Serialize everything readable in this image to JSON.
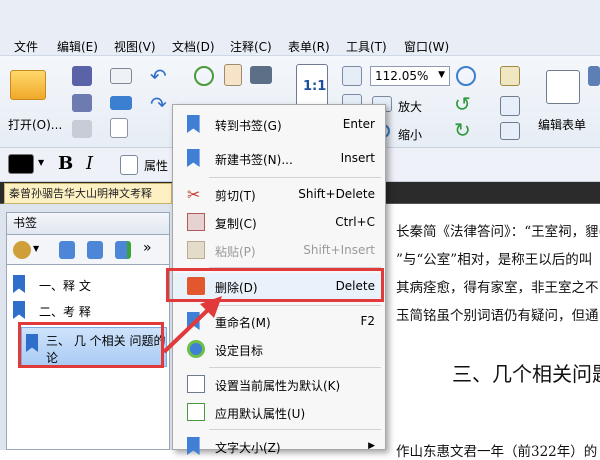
{
  "menubar": {
    "items": [
      "文件",
      "编辑(E)",
      "视图(V)",
      "文档(D)",
      "注释(C)",
      "表单(R)",
      "工具(T)",
      "窗口(W)"
    ]
  },
  "toolbar": {
    "open_label": "打开(O)...",
    "zoom_value": "112.05%",
    "fit_label": "1:1",
    "enlarge_label": "放大",
    "shrink_label": "缩小",
    "edit_form_label": "编辑表单",
    "bold_label": "B",
    "italic_label": "I",
    "props_label": "属性"
  },
  "tab": {
    "title": "秦曾孙骃告华大山明神文考释"
  },
  "bookmarks": {
    "panel_title": "书签",
    "items": [
      {
        "label": "一、释 文"
      },
      {
        "label": "二、考 释"
      },
      {
        "label_line1": "三、 几 个相关 问题的",
        "label_line2": "论"
      }
    ]
  },
  "document": {
    "lines": [
      "长秦简《法律答问》：“王室祠，貍(",
      "”与“公室”相对，是称王以后的叫",
      "其病痊愈，得有家室，非王室之不",
      "玉简铭虽个别词语仍有疑问，但通",
      "三、几个相关问题",
      "作山东惠文君一年（前322年）的"
    ]
  },
  "context_menu": {
    "items": [
      {
        "label": "转到书签(G)",
        "key": "Enter",
        "icon": "goto-bookmark-icon",
        "disabled": false
      },
      {
        "label": "新建书签(N)...",
        "key": "Insert",
        "icon": "new-bookmark-icon",
        "disabled": false
      },
      {
        "label": "剪切(T)",
        "key": "Shift+Delete",
        "icon": "scissors-icon",
        "disabled": false
      },
      {
        "label": "复制(C)",
        "key": "Ctrl+C",
        "icon": "copy-icon",
        "disabled": false
      },
      {
        "label": "粘贴(P)",
        "key": "Shift+Insert",
        "icon": "paste-icon",
        "disabled": true
      },
      {
        "label": "删除(D)",
        "key": "Delete",
        "icon": "trash-icon",
        "disabled": false
      },
      {
        "label": "重命名(M)",
        "key": "F2",
        "icon": "rename-icon",
        "disabled": false
      },
      {
        "label": "设定目标",
        "key": "",
        "icon": "set-target-icon",
        "disabled": false
      },
      {
        "label": "设置当前属性为默认(K)",
        "key": "",
        "icon": "set-default-icon",
        "disabled": false
      },
      {
        "label": "应用默认属性(U)",
        "key": "",
        "icon": "apply-default-icon",
        "disabled": false
      },
      {
        "label": "文字大小(Z)",
        "key": "",
        "icon": "text-size-icon",
        "disabled": false
      }
    ]
  },
  "colors": {
    "highlight": "#e03a3a",
    "bookmark_blue": "#2f6fcb",
    "tab_bg": "#fdf1c4"
  }
}
